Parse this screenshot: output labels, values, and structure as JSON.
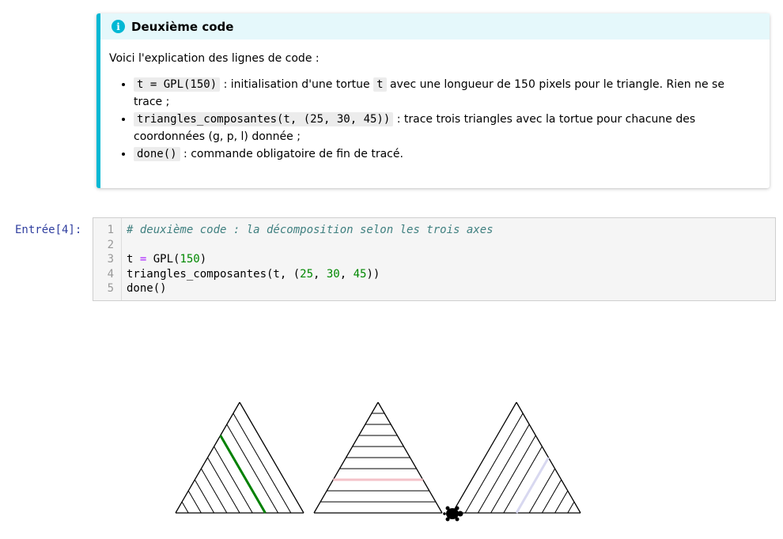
{
  "admonition": {
    "icon": "info-icon",
    "title": "Deuxième code",
    "intro": "Voici l'explication des lignes de code :",
    "items": [
      {
        "code": "t = GPL(150)",
        "text_a": " : initialisation d'une tortue ",
        "code2": "t",
        "text_b": " avec une longueur de 150 pixels pour le triangle. Rien ne se trace ;"
      },
      {
        "code": "triangles_composantes(t, (25, 30, 45))",
        "text_a": " : trace trois triangles avec la tortue pour chacune des coordonnées (g, p, l) donnée ;"
      },
      {
        "code": "done()",
        "text_a": " : commande obligatoire de fin de tracé."
      }
    ]
  },
  "cell": {
    "prompt": "Entrée[4]:",
    "line_numbers": [
      "1",
      "2",
      "3",
      "4",
      "5"
    ],
    "lines": {
      "l1_comment": "# deuxième code : la décomposition selon les trois axes",
      "l3_a": "t ",
      "l3_op": "=",
      "l3_b": " GPL(",
      "l3_num": "150",
      "l3_c": ")",
      "l4_a": "triangles_composantes(t, (",
      "l4_n1": "25",
      "l4_s1": ", ",
      "l4_n2": "30",
      "l4_s2": ", ",
      "l4_n3": "45",
      "l4_c": "))",
      "l5": "done()"
    }
  },
  "output": {
    "triangle_count": 3,
    "highlight_colors": [
      "#008000",
      "#f4c2c8",
      "#d8d8f0"
    ],
    "turtle_icon": "turtle-icon"
  }
}
